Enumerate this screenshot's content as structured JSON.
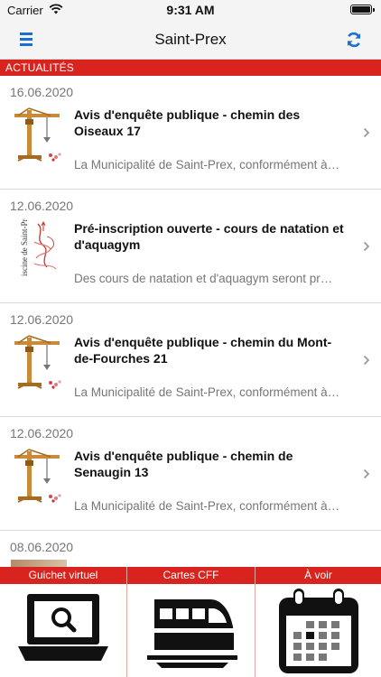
{
  "statusbar": {
    "carrier": "Carrier",
    "time": "9:31 AM"
  },
  "navbar": {
    "title": "Saint-Prex",
    "menu_icon": "hamburger-icon",
    "refresh_icon": "refresh-icon",
    "accent": "#1a6fd1"
  },
  "section": {
    "title": "ACTUALITÉS",
    "color": "#d9231e"
  },
  "news": [
    {
      "date": "16.06.2020",
      "title": "Avis d'enquête publique - chemin des Oiseaux 17",
      "excerpt": "La Municipalité de Saint-Prex, conformément à…",
      "thumb": "crane-icon"
    },
    {
      "date": "12.06.2020",
      "title": "Pré-inscription ouverte - cours de natation et d'aquagym",
      "excerpt": "Des cours de natation et d'aquagym seront pr…",
      "thumb": "piscine-logo",
      "thumb_text": "iscine de Saint-Prex"
    },
    {
      "date": "12.06.2020",
      "title": "Avis d'enquête publique - chemin du Mont-de-Fourches 21",
      "excerpt": "La Municipalité de Saint-Prex, conformément à…",
      "thumb": "crane-icon"
    },
    {
      "date": "12.06.2020",
      "title": "Avis d'enquête publique - chemin de Senaugin 13",
      "excerpt": "La Municipalité de Saint-Prex, conformément à…",
      "thumb": "crane-icon"
    },
    {
      "date": "08.06.2020",
      "title": "",
      "excerpt": "",
      "thumb": "photo-thumbnail"
    }
  ],
  "tabs": [
    {
      "label": "Guichet virtuel",
      "icon": "laptop-search-icon"
    },
    {
      "label": "Cartes CFF",
      "icon": "train-icon"
    },
    {
      "label": "À voir",
      "icon": "calendar-icon"
    }
  ]
}
